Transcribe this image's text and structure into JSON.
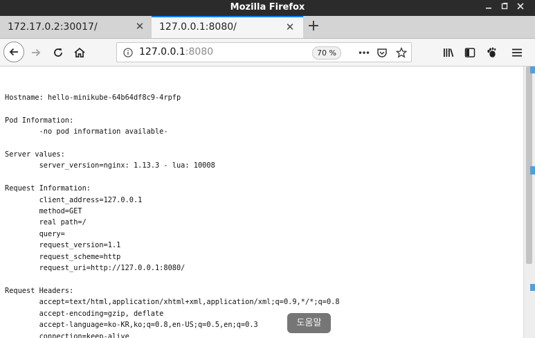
{
  "window": {
    "title": "Mozilla Firefox"
  },
  "tabs": [
    {
      "label": "172.17.0.2:30017/",
      "active": false
    },
    {
      "label": "127.0.0.1:8080/",
      "active": true
    }
  ],
  "toolbar": {
    "url_host": "127.0.0.1",
    "url_port": ":8080",
    "zoom": "70 %"
  },
  "page": {
    "lines": [
      "Hostname: hello-minikube-64b64df8c9-4rpfp",
      "",
      "Pod Information:",
      "\t-no pod information available-",
      "",
      "Server values:",
      "\tserver_version=nginx: 1.13.3 - lua: 10008",
      "",
      "Request Information:",
      "\tclient_address=127.0.0.1",
      "\tmethod=GET",
      "\treal path=/",
      "\tquery=",
      "\trequest_version=1.1",
      "\trequest_scheme=http",
      "\trequest_uri=http://127.0.0.1:8080/",
      "",
      "Request Headers:",
      "\taccept=text/html,application/xhtml+xml,application/xml;q=0.9,*/*;q=0.8",
      "\taccept-encoding=gzip, deflate",
      "\taccept-language=ko-KR,ko;q=0.8,en-US;q=0.5,en;q=0.3",
      "\tconnection=keep-alive"
    ]
  },
  "overlay": {
    "help_label": "도움말"
  },
  "colors": {
    "accent": "#0a84ff",
    "titlebar": "#2b2b2b"
  }
}
